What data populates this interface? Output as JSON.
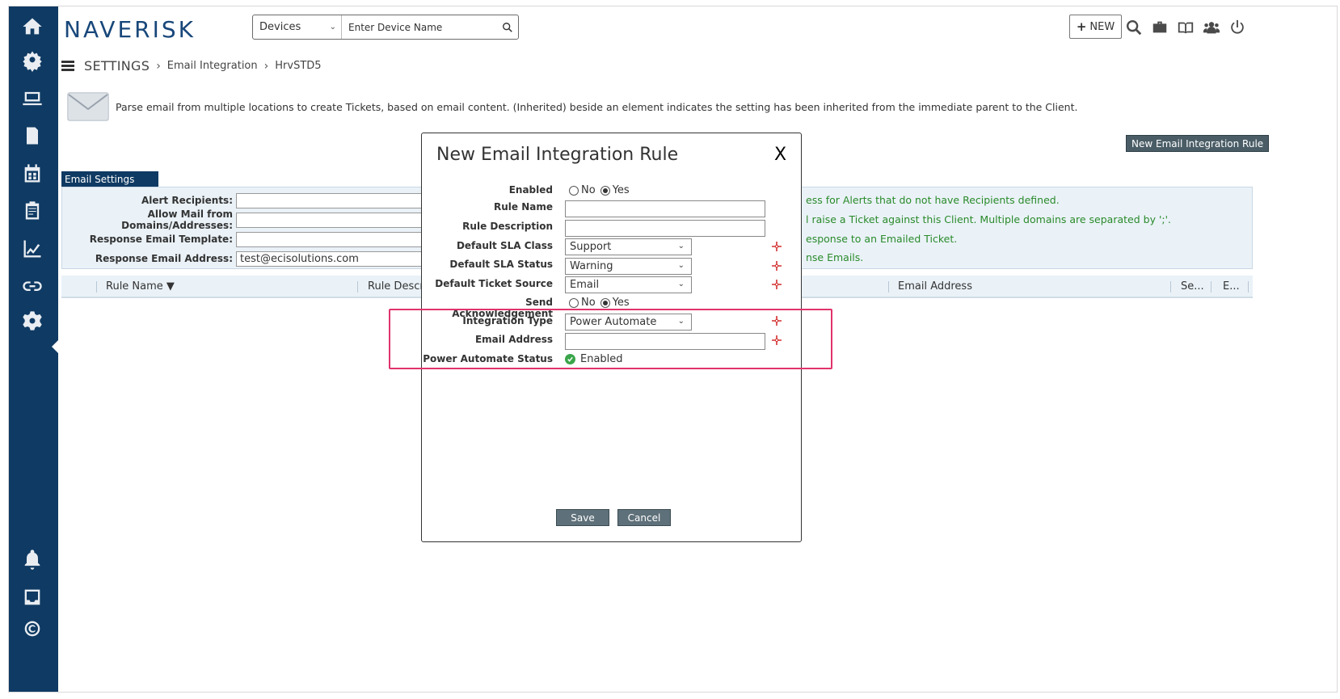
{
  "header": {
    "logo": "NAVERISK",
    "search_type": "Devices",
    "search_placeholder": "Enter Device Name",
    "new_button": "NEW"
  },
  "breadcrumb": {
    "root": "SETTINGS",
    "level1": "Email Integration",
    "level2": "HrvSTD5"
  },
  "info": {
    "text": "Parse email from multiple locations to create Tickets, based on email content. (Inherited) beside an element indicates the setting has been inherited from the immediate parent to the Client."
  },
  "new_rule_button": "New Email Integration Rule",
  "email_settings": {
    "tab": "Email Settings",
    "rows": [
      {
        "label": "Alert Recipients:",
        "value": "",
        "help": "ess for Alerts that do not have Recipients defined."
      },
      {
        "label": "Allow Mail from Domains/Addresses:",
        "value": "",
        "help": "l raise a Ticket against this Client. Multiple domains are separated by ';'."
      },
      {
        "label": "Response Email Template:",
        "value": "",
        "help": "esponse to an Emailed Ticket."
      },
      {
        "label": "Response Email Address:",
        "value": "test@ecisolutions.com",
        "help": "nse Emails."
      }
    ]
  },
  "grid": {
    "col_rule_name": "Rule Name ▼",
    "col_rule_desc": "Rule Descri",
    "col_email": "Email Address",
    "col_se": "Se...",
    "col_e": "E..."
  },
  "modal": {
    "title": "New Email Integration Rule",
    "close": "X",
    "labels": {
      "enabled": "Enabled",
      "rule_name": "Rule Name",
      "rule_description": "Rule Description",
      "default_sla_class": "Default SLA Class",
      "default_sla_status": "Default SLA Status",
      "default_ticket_source": "Default Ticket Source",
      "send_ack": "Send Acknowledgement",
      "integration_type": "Integration Type",
      "email_address": "Email Address",
      "pa_status": "Power Automate Status"
    },
    "radio_no": "No",
    "radio_yes": "Yes",
    "sla_class": "Support",
    "sla_status": "Warning",
    "ticket_source": "Email",
    "integration_type": "Power Automate",
    "pa_status_value": "Enabled",
    "save": "Save",
    "cancel": "Cancel"
  },
  "colors": {
    "sidebar": "#0f3a63",
    "accent": "#18477a",
    "help_text": "#2a8a2a",
    "highlight": "#e0336b",
    "required": "#d32f2f"
  }
}
